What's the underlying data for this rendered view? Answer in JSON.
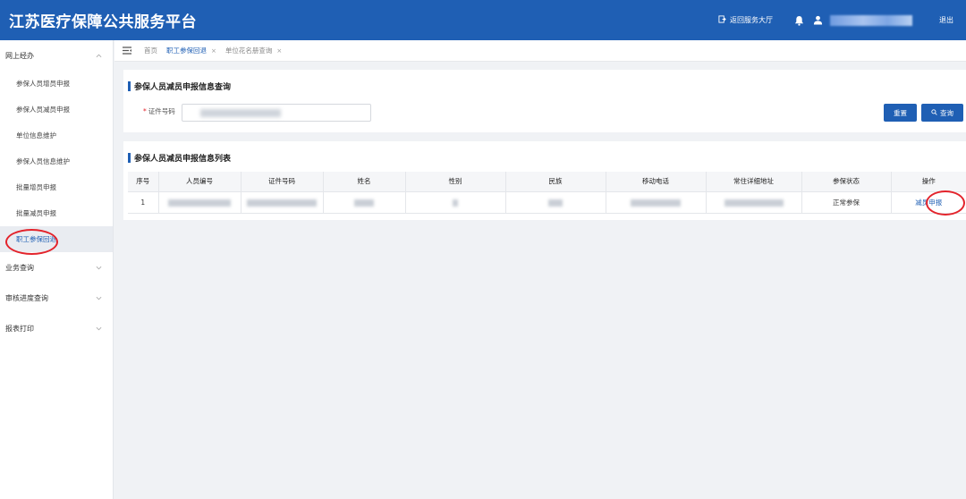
{
  "header": {
    "title": "江苏医疗保障公共服务平台",
    "back_to_hall": "返回服务大厅",
    "logout": "退出"
  },
  "sidebar": {
    "groups": [
      {
        "label": "网上经办",
        "expanded": true,
        "items": [
          {
            "label": "参保人员增员申报"
          },
          {
            "label": "参保人员减员申报"
          },
          {
            "label": "单位信息维护"
          },
          {
            "label": "参保人员信息维护"
          },
          {
            "label": "批量增员申报"
          },
          {
            "label": "批量减员申报"
          },
          {
            "label": "职工参保回退",
            "active": true
          }
        ]
      },
      {
        "label": "业务查询",
        "expanded": false
      },
      {
        "label": "审核进度查询",
        "expanded": false
      },
      {
        "label": "报表打印",
        "expanded": false
      }
    ]
  },
  "tabs": [
    {
      "label": "首页",
      "closable": false
    },
    {
      "label": "职工参保回退",
      "closable": true,
      "active": true
    },
    {
      "label": "单位花名册查询",
      "closable": true
    }
  ],
  "query": {
    "title": "参保人员减员申报信息查询",
    "id_label": "证件号码",
    "reset_label": "重置",
    "search_label": "查询"
  },
  "list": {
    "title": "参保人员减员申报信息列表",
    "columns": [
      "序号",
      "人员编号",
      "证件号码",
      "姓名",
      "性别",
      "民族",
      "移动电话",
      "常住详细地址",
      "参保状态",
      "操作"
    ],
    "rows": [
      {
        "index": "1",
        "status": "正常参保",
        "action": "减员申报"
      }
    ]
  },
  "colors": {
    "primary": "#1f5fb4",
    "annotation_red": "#e3232b",
    "background": "#f0f2f5"
  }
}
